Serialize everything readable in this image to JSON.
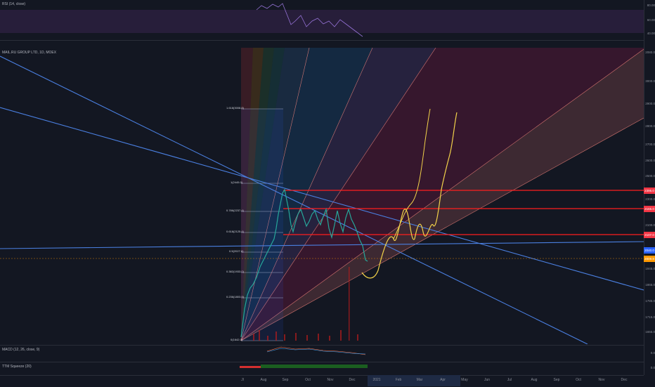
{
  "panes": {
    "rsi_label": "RSI (14, close)",
    "main_label": "MAIL.RU GROUP LTD, 1D, MOEX",
    "macd_label": "MACD (12, 26, close, 9)",
    "ttm_label": "TTM Squeeze (20)"
  },
  "rsi_axis": [
    "80.00",
    "60.00",
    "40.00"
  ],
  "price_axis": [
    "2080.0",
    "3000.0",
    "2900.0",
    "2800.0",
    "2700.0",
    "2600.0",
    "2500.0",
    "2400.0",
    "2300.0",
    "2200.0",
    "2100.0",
    "2000.0",
    "1945.0",
    "1865.0",
    "1785.0",
    "1715.0",
    "1655.0"
  ],
  "price_tags": [
    {
      "label": "2395.0",
      "color": "#f23645"
    },
    {
      "label": "2165.0",
      "color": "#f23645"
    },
    {
      "label": "2107.0",
      "color": "#f23645"
    },
    {
      "label": "2040.0",
      "color": "#2962ff"
    },
    {
      "label": "2009.8",
      "color": "#ff9800"
    }
  ],
  "macd_axis": [
    "0.0"
  ],
  "ttm_axis": [
    "0.0"
  ],
  "fib_levels": [
    "1.618(3008.8)",
    "1(2445.0)",
    "0.786(2237.4)",
    "0.618(2125.4)",
    "0.5(2027.6)",
    "0.382(1933.0)",
    "0.236(1803.9)",
    "0(1642.0)"
  ],
  "time_axis": [
    "Jl",
    "Aug",
    "Sep",
    "Oct",
    "Nov",
    "Dec",
    "2021",
    "Feb",
    "Mar",
    "Apr",
    "May",
    "Jun",
    "Jul",
    "Aug",
    "Sep",
    "Oct",
    "Nov",
    "Dec"
  ],
  "colors": {
    "background": "#131722",
    "trendline": "#4a7fe0",
    "resistance": "#ff1e1e",
    "projection": "#f2d24a"
  }
}
